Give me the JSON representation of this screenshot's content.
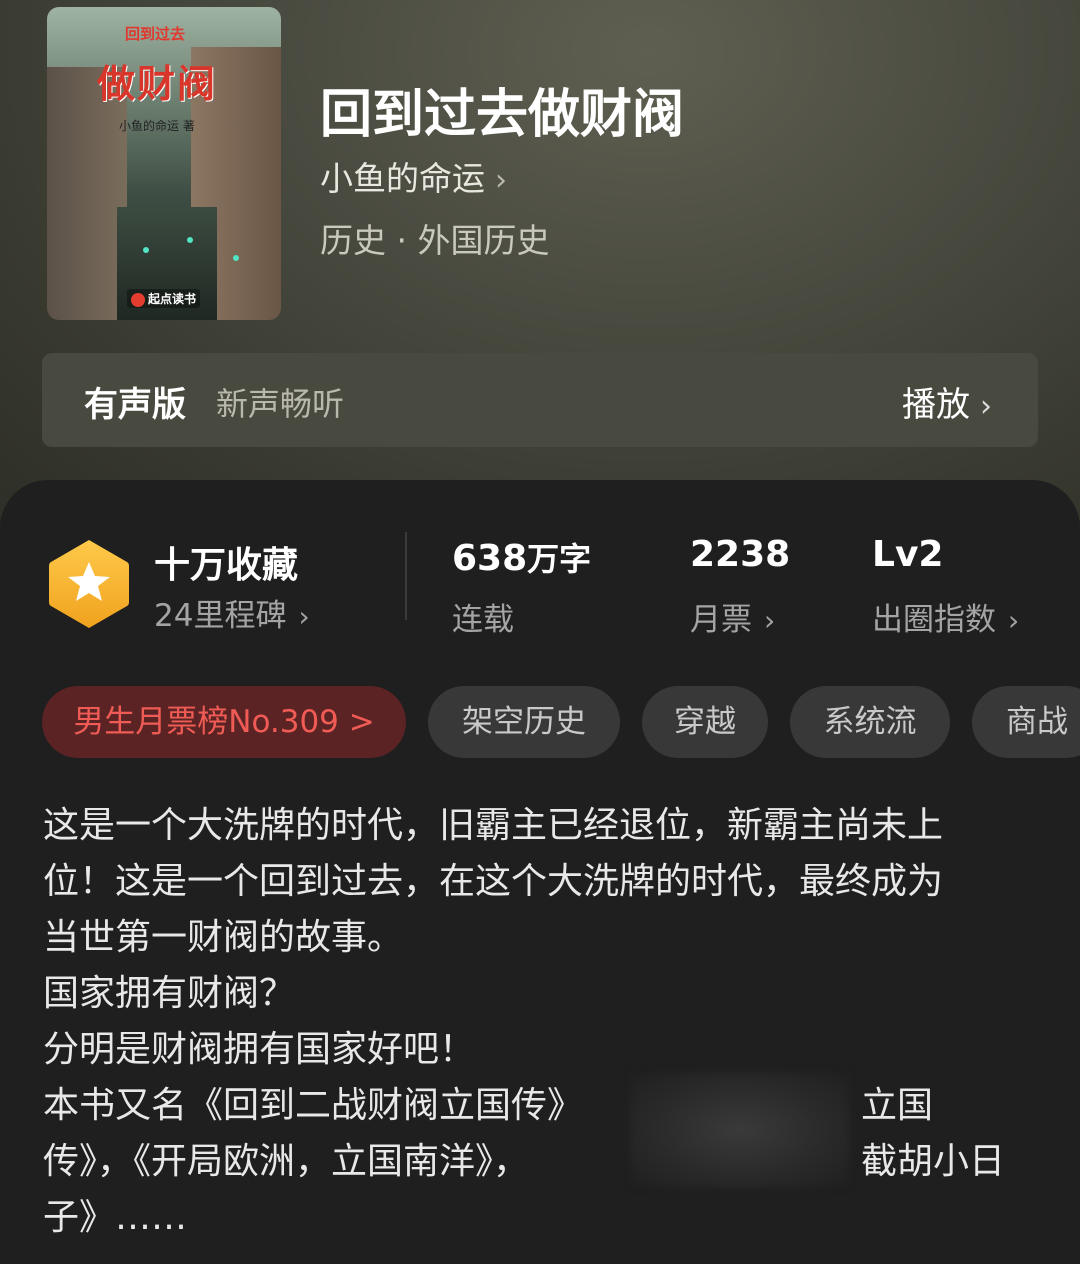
{
  "book": {
    "title": "回到过去做财阀",
    "author": "小鱼的命运",
    "genre": "历史 · 外国历史",
    "cover": {
      "small_title": "回到过去",
      "big_title": "做财阀",
      "author_line": "小鱼的命运 著",
      "publisher": "起点读书"
    }
  },
  "audio": {
    "label": "有声版",
    "subtitle": "新声畅听",
    "play_label": "播放"
  },
  "stats": {
    "milestone": {
      "title": "十万收藏",
      "sub": "24里程碑"
    },
    "words": {
      "value": "638",
      "unit": "万字",
      "sub": "连载"
    },
    "votes": {
      "value": "2238",
      "sub": "月票"
    },
    "level": {
      "value": "Lv2",
      "sub": "出圈指数"
    }
  },
  "tags": [
    "男生月票榜No.309 >",
    "架空历史",
    "穿越",
    "系统流",
    "商战"
  ],
  "description": [
    "这是一个大洗牌的时代，旧霸主已经退位，新霸主尚未上",
    "位！这是一个回到过去，在这个大洗牌的时代，最终成为",
    "当世第一财阀的故事。",
    "国家拥有财阀？",
    "分明是财阀拥有国家好吧！",
    "本书又名《回到二战财阀立国传》",
    "立国",
    "传》，《开局欧洲，立国南洋》，",
    "截胡小日",
    "子》……"
  ],
  "colors": {
    "panel_bg": "#1f1f1f",
    "badge": "#f5b631",
    "rank_tag_bg": "#5b2324",
    "rank_tag_text": "#f05c55"
  },
  "icons": [
    "chevron-right-icon",
    "star-badge-icon"
  ]
}
